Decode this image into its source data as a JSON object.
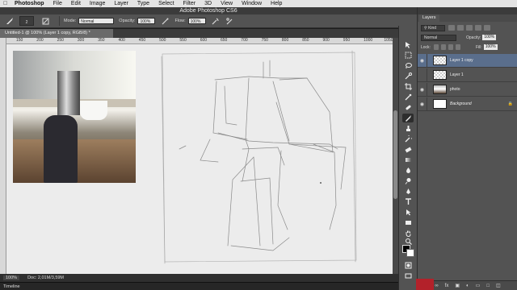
{
  "menubar": {
    "apple_icon": "apple-icon",
    "items": [
      "Photoshop",
      "File",
      "Edit",
      "Image",
      "Layer",
      "Type",
      "Select",
      "Filter",
      "3D",
      "View",
      "Window",
      "Help"
    ]
  },
  "app_title": "Adobe Photoshop CS6",
  "options": {
    "brush_size": "2",
    "mode_label": "Mode:",
    "mode_value": "Normal",
    "opacity_label": "Opacity:",
    "opacity_value": "100%",
    "flow_label": "Flow:",
    "flow_value": "100%"
  },
  "document": {
    "tab_title": "Untitled-1 @ 100% (Layer 1 copy, RGB/8) *"
  },
  "ruler": {
    "labels": [
      "150",
      "200",
      "250",
      "300",
      "350",
      "400",
      "450",
      "500",
      "550",
      "600",
      "650",
      "700",
      "750",
      "800",
      "850",
      "900",
      "950",
      "1000",
      "1050"
    ]
  },
  "status": {
    "zoom": "100%",
    "doc": "Doc: 2,01M/3,59M"
  },
  "timeline_label": "Timeline",
  "panels": {
    "layers_tab": "Layers",
    "kind_label": "Kind",
    "blend_value": "Normal",
    "opacity_label": "Opacity:",
    "opacity_value": "100%",
    "lock_label": "Lock:",
    "fill_label": "Fill:",
    "fill_value": "100%",
    "layers": [
      {
        "name": "Layer 1 copy",
        "visible": true,
        "selected": true
      },
      {
        "name": "Layer 1",
        "visible": false,
        "selected": false
      },
      {
        "name": "photo",
        "visible": true,
        "selected": false
      },
      {
        "name": "Background",
        "visible": true,
        "selected": false
      }
    ]
  },
  "colors": {
    "selected_layer": "#5a6e8c",
    "canvas": "#ececec",
    "panel": "#535353"
  }
}
